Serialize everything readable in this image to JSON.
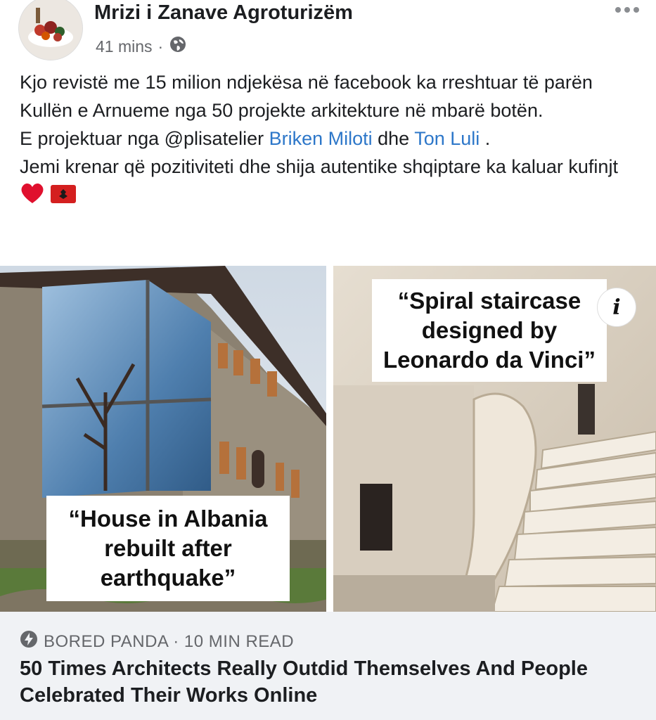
{
  "post": {
    "author": "Mrizi i Zanave Agroturizëm",
    "time": "41 mins",
    "separator": "·",
    "privacy_icon": "globe-icon",
    "more_icon": "more-options-icon",
    "text": {
      "line1": "Kjo revistë me 15 milion ndjekësa në facebook ka rreshtuar të parën Kullën e Arnueme nga 50 projekte arkitekture në mbarë botën.",
      "line2_prefix": "E projektuar nga @plisatelier ",
      "mention1": "Briken Miloti",
      "line2_mid": " dhe ",
      "mention2": "Ton Luli",
      "line2_suffix": " .",
      "line3": "Jemi krenar që pozitiviteti dhe shija autentike shqiptare ka kaluar kufinjt",
      "emojis": [
        "heart-emoji",
        "albania-flag-emoji"
      ]
    }
  },
  "images": {
    "left_caption": "“House in Albania rebuilt after earthquake”",
    "right_caption": "“Spiral staircase designed by Leonardo da Vinci”",
    "info_label": "i"
  },
  "link_card": {
    "source": "BORED PANDA · 10 MIN READ",
    "source_icon": "lightning-icon",
    "title": "50 Times Architects Really Outdid Themselves And People Celebrated Their Works Online"
  },
  "colors": {
    "link": "#2d77c9",
    "secondary_text": "#65676b",
    "card_background": "#f0f2f5"
  }
}
